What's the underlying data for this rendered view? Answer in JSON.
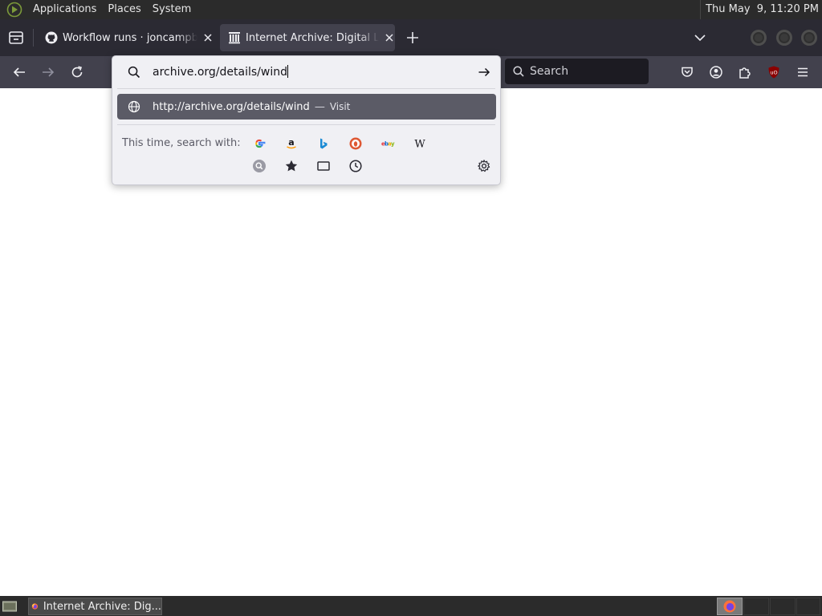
{
  "top_panel": {
    "menus": [
      "Applications",
      "Places",
      "System"
    ],
    "clock": "Thu May  9, 11:20 PM"
  },
  "tabs": [
    {
      "title": "Workflow runs · joncampbell",
      "favicon": "github-icon",
      "active": false
    },
    {
      "title": "Internet Archive: Digital Library",
      "favicon": "archive-icon",
      "active": true
    }
  ],
  "toolbar": {
    "search_placeholder": "Search"
  },
  "urlbar": {
    "value": "archive.org/details/wind",
    "suggestion": {
      "url": "http://archive.org/details/wind",
      "separator": "—",
      "action": "Visit"
    },
    "one_off_label": "This time, search with:",
    "engines": [
      "Google",
      "Amazon",
      "Bing",
      "DuckDuckGo",
      "eBay",
      "Wikipedia"
    ],
    "modes": [
      "Search engines",
      "Bookmarks",
      "Tabs",
      "History"
    ]
  },
  "taskbar": {
    "window_title": "Internet Archive: Dig..."
  },
  "colors": {
    "panel_bg": "#2b2b2b",
    "tabstrip_bg": "#2b2a33",
    "toolbar_bg": "#42414d",
    "highlight": "#5b5b66"
  }
}
